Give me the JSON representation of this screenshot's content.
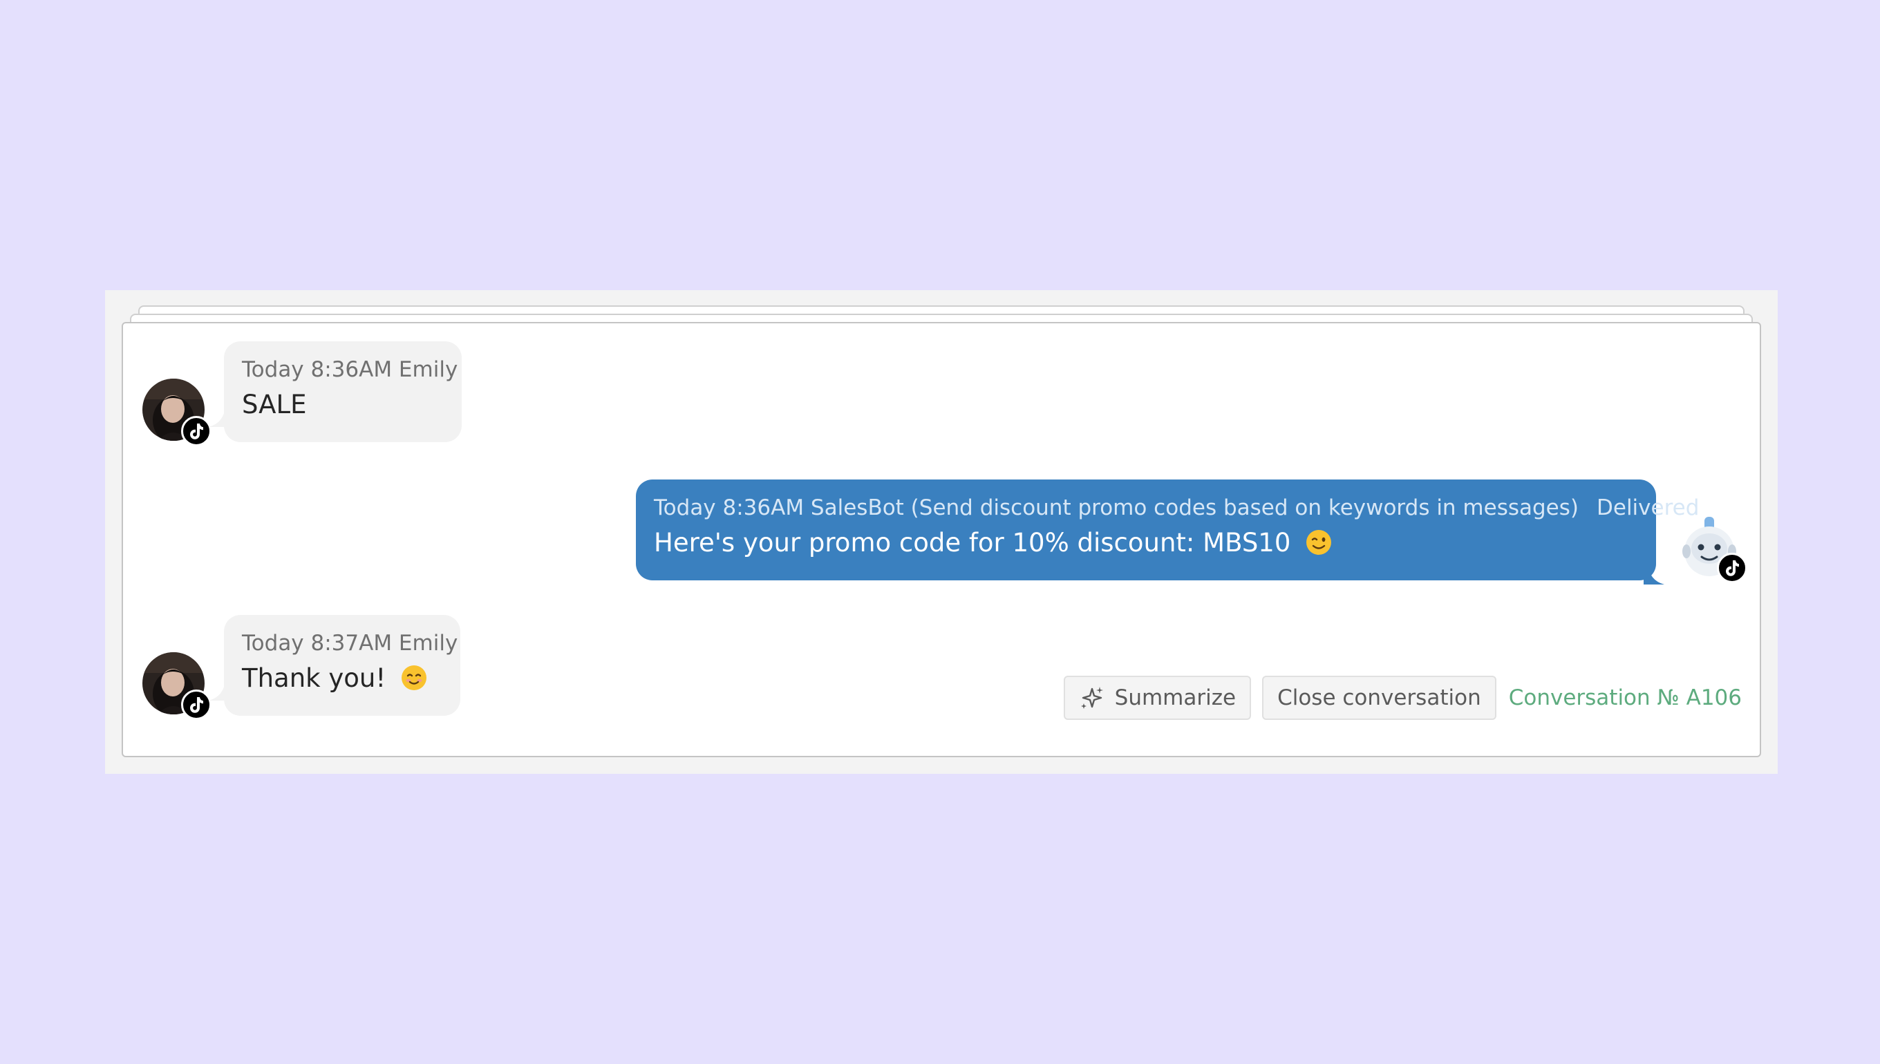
{
  "conversation": {
    "messages": [
      {
        "direction": "incoming",
        "timestamp": "Today 8:36AM",
        "author": "Emily",
        "meta": "Today 8:36AM Emily",
        "text": "SALE",
        "channel_icon": "tiktok-icon"
      },
      {
        "direction": "outgoing",
        "timestamp": "Today 8:36AM",
        "author": "SalesBot (Send discount promo codes based on keywords in messages)",
        "meta": "Today 8:36AM SalesBot (Send discount promo codes based on keywords in messages)",
        "status": "Delivered",
        "text": "Here's your promo code for 10% discount: MBS10",
        "emoji": "wink-emoji",
        "channel_icon": "tiktok-icon"
      },
      {
        "direction": "incoming",
        "timestamp": "Today 8:37AM",
        "author": "Emily",
        "meta": "Today 8:37AM Emily",
        "text": "Thank you!",
        "emoji": "smiling-emoji",
        "channel_icon": "tiktok-icon"
      }
    ],
    "actions": {
      "summarize_label": "Summarize",
      "close_label": "Close conversation",
      "conversation_number": "Conversation № A106"
    }
  },
  "colors": {
    "page_background": "#e4e0fd",
    "outgoing_bubble": "#3a80bf",
    "incoming_bubble": "#f2f2f2",
    "conversation_number": "#5dab7e"
  }
}
